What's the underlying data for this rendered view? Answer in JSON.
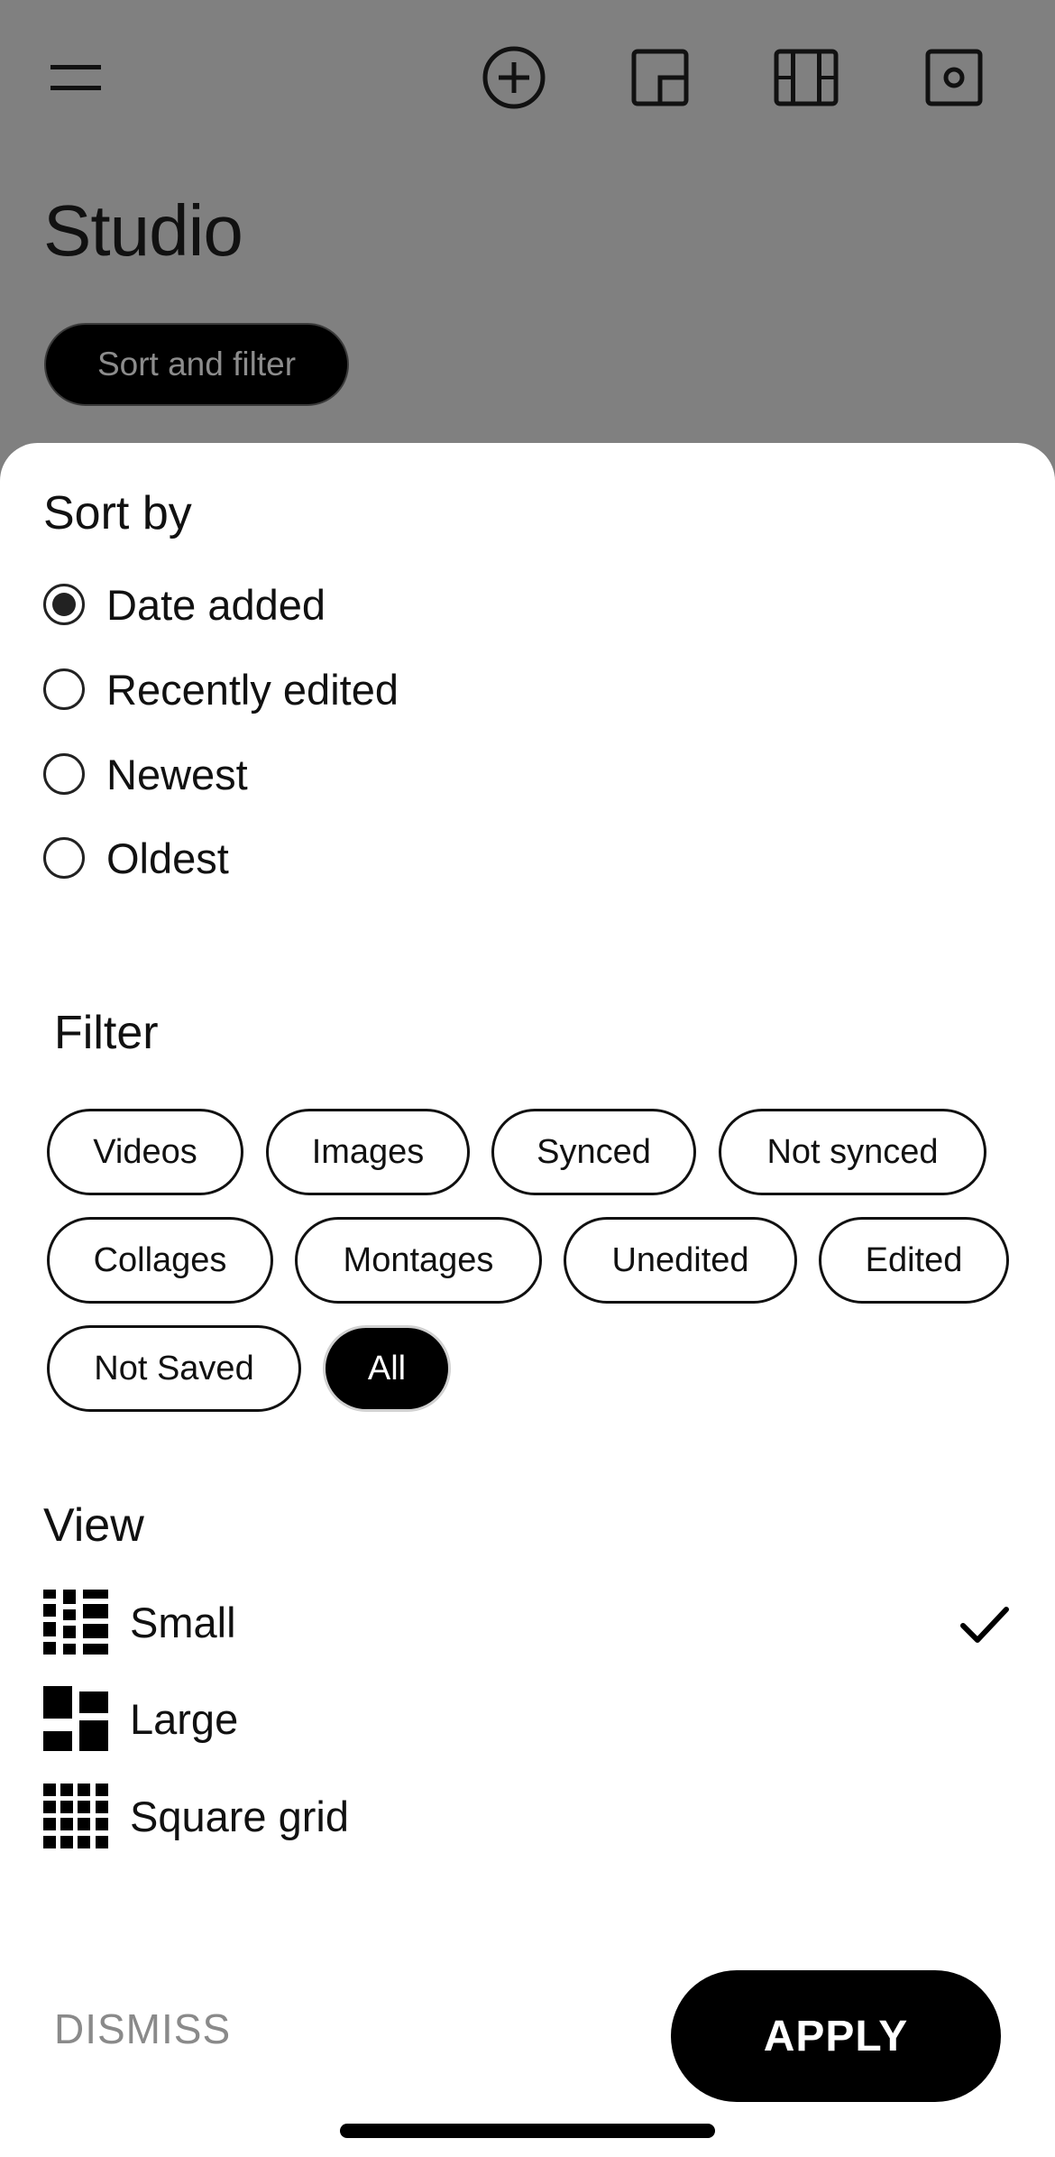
{
  "header": {
    "title": "Studio",
    "sort_filter_label": "Sort and filter",
    "icons": [
      "menu-icon",
      "add-circle-icon",
      "collage-layout-icon",
      "film-strip-icon",
      "camera-square-icon"
    ]
  },
  "sheet": {
    "sort": {
      "title": "Sort by",
      "options": [
        {
          "label": "Date added",
          "selected": true
        },
        {
          "label": "Recently edited",
          "selected": false
        },
        {
          "label": "Newest",
          "selected": false
        },
        {
          "label": "Oldest",
          "selected": false
        }
      ]
    },
    "filter": {
      "title": "Filter",
      "chips": [
        {
          "label": "Videos",
          "selected": false
        },
        {
          "label": "Images",
          "selected": false
        },
        {
          "label": "Synced",
          "selected": false
        },
        {
          "label": "Not synced",
          "selected": false
        },
        {
          "label": "Collages",
          "selected": false
        },
        {
          "label": "Montages",
          "selected": false
        },
        {
          "label": "Unedited",
          "selected": false
        },
        {
          "label": "Edited",
          "selected": false
        },
        {
          "label": "Not Saved",
          "selected": false
        },
        {
          "label": "All",
          "selected": true
        }
      ]
    },
    "view": {
      "title": "View",
      "options": [
        {
          "label": "Small",
          "icon": "small-grid-icon",
          "selected": true
        },
        {
          "label": "Large",
          "icon": "large-grid-icon",
          "selected": false
        },
        {
          "label": "Square grid",
          "icon": "square-grid-icon",
          "selected": false
        }
      ]
    },
    "actions": {
      "dismiss_label": "DISMISS",
      "apply_label": "APPLY"
    }
  },
  "colors": {
    "backdrop": "#808080",
    "sheet": "#ffffff",
    "accent": "#000000",
    "muted_text": "#8a8a8a"
  }
}
